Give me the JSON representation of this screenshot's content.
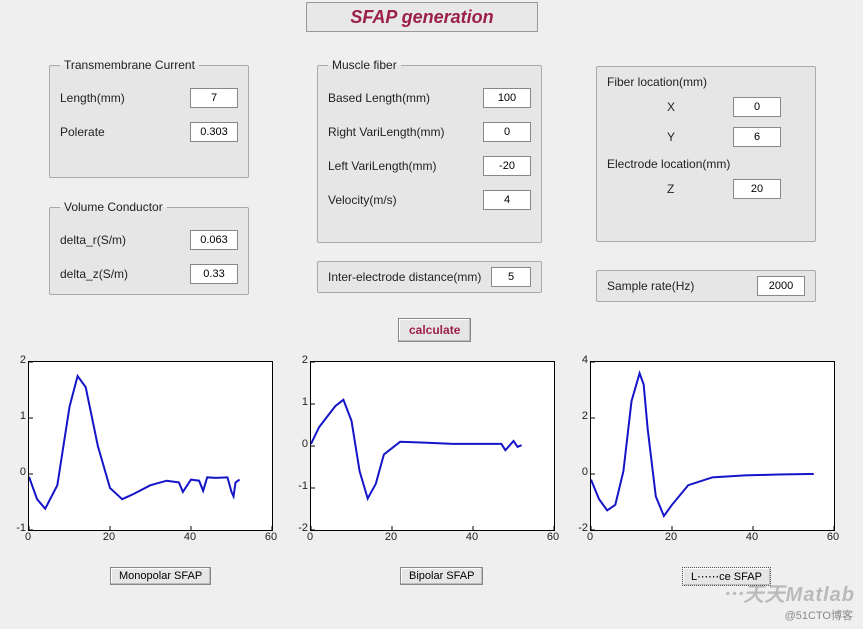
{
  "title": "SFAP generation",
  "trans_current": {
    "legend": "Transmembrane Current",
    "length_label": "Length(mm)",
    "length_value": "7",
    "polerate_label": "Polerate",
    "polerate_value": "0.303"
  },
  "volume_conductor": {
    "legend": "Volume Conductor",
    "delta_r_label": "delta_r(S/m)",
    "delta_r_value": "0.063",
    "delta_z_label": "delta_z(S/m)",
    "delta_z_value": "0.33"
  },
  "muscle_fiber": {
    "legend": "Muscle fiber",
    "based_length_label": "Based Length(mm)",
    "based_length_value": "100",
    "right_vari_label": "Right VariLength(mm)",
    "right_vari_value": "0",
    "left_vari_label": "Left VariLength(mm)",
    "left_vari_value": "-20",
    "velocity_label": "Velocity(m/s)",
    "velocity_value": "4"
  },
  "inter_electrode": {
    "label": "Inter-electrode distance(mm)",
    "value": "5"
  },
  "fiber_loc": {
    "hdr": "Fiber location(mm)",
    "x_label": "X",
    "x_value": "0",
    "y_label": "Y",
    "y_value": "6"
  },
  "electrode_loc": {
    "hdr": "Electrode location(mm)",
    "z_label": "Z",
    "z_value": "20"
  },
  "sample_rate": {
    "label": "Sample rate(Hz)",
    "value": "2000"
  },
  "buttons": {
    "calculate": "calculate",
    "monopolar": "Monopolar SFAP",
    "bipolar": "Bipolar SFAP",
    "laplace": "L⋯⋯ce SFAP"
  },
  "watermark": "⋯天天Matlab",
  "watermark_sub": "@51CTO博客",
  "chart_data": [
    {
      "type": "line",
      "title": "Monopolar SFAP",
      "xlim": [
        0,
        60
      ],
      "ylim": [
        -1,
        2
      ],
      "xticks": [
        0,
        20,
        40,
        60
      ],
      "yticks": [
        -1,
        0,
        1,
        2
      ],
      "x": [
        0,
        2,
        4,
        7,
        10,
        12,
        14,
        17,
        20,
        23,
        26,
        30,
        34,
        37,
        38,
        40,
        42,
        43,
        44,
        46,
        49,
        50,
        50.5,
        51,
        52
      ],
      "y": [
        -0.05,
        -0.45,
        -0.62,
        -0.2,
        1.2,
        1.75,
        1.55,
        0.5,
        -0.25,
        -0.45,
        -0.35,
        -0.2,
        -0.12,
        -0.15,
        -0.32,
        -0.1,
        -0.12,
        -0.3,
        -0.06,
        -0.07,
        -0.06,
        -0.32,
        -0.4,
        -0.15,
        -0.1
      ]
    },
    {
      "type": "line",
      "title": "Bipolar SFAP",
      "xlim": [
        0,
        60
      ],
      "ylim": [
        -2,
        2
      ],
      "xticks": [
        0,
        20,
        40,
        60
      ],
      "yticks": [
        -2,
        -1,
        0,
        1,
        2
      ],
      "x": [
        0,
        2,
        4,
        6,
        8,
        10,
        12,
        14,
        16,
        18,
        22,
        28,
        35,
        42,
        47,
        48,
        50,
        51,
        52
      ],
      "y": [
        0.05,
        0.45,
        0.7,
        0.95,
        1.1,
        0.6,
        -0.6,
        -1.25,
        -0.9,
        -0.2,
        0.1,
        0.08,
        0.05,
        0.05,
        0.05,
        -0.1,
        0.12,
        -0.02,
        0.02
      ]
    },
    {
      "type": "line",
      "title": "Laplace SFAP",
      "xlim": [
        0,
        60
      ],
      "ylim": [
        -2,
        4
      ],
      "xticks": [
        0,
        20,
        40,
        60
      ],
      "yticks": [
        -2,
        0,
        2,
        4
      ],
      "x": [
        0,
        2,
        4,
        6,
        8,
        10,
        12,
        13,
        14,
        16,
        18,
        20,
        24,
        30,
        38,
        46,
        54,
        55
      ],
      "y": [
        -0.2,
        -0.9,
        -1.3,
        -1.1,
        0.1,
        2.6,
        3.6,
        3.2,
        1.6,
        -0.8,
        -1.5,
        -1.1,
        -0.4,
        -0.12,
        -0.05,
        -0.02,
        0.0,
        0.0
      ]
    }
  ]
}
